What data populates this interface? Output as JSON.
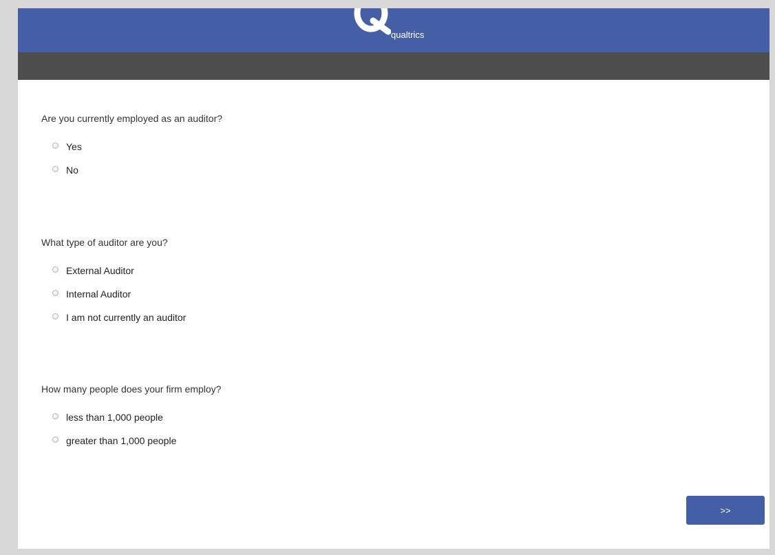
{
  "header": {
    "logo_text": "qualtrics",
    "logo_icon": "qualtrics-q-logo-icon",
    "brand_color": "#445fa6",
    "subbar_color": "#4d4d4d"
  },
  "questions": [
    {
      "text": "Are you currently employed as an auditor?",
      "choices": [
        "Yes",
        "No"
      ]
    },
    {
      "text": "What type of auditor are you?",
      "choices": [
        "External Auditor",
        "Internal Auditor",
        "I am not currently an auditor"
      ]
    },
    {
      "text": "How many people does your firm employ?",
      "choices": [
        "less than 1,000 people",
        "greater than 1,000 people"
      ]
    }
  ],
  "footer": {
    "next_label": ">>"
  }
}
